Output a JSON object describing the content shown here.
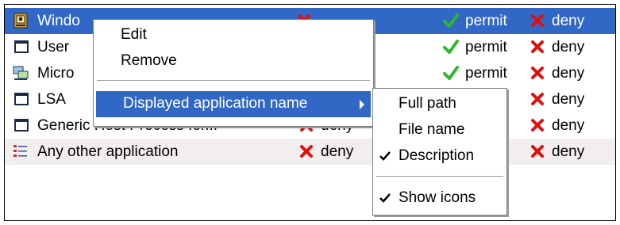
{
  "rules": [
    {
      "name": "Windows NT Logon App",
      "icon": "windows-logon-icon",
      "allow1_label": "deny",
      "allow1": false,
      "allow2_label": "permit",
      "allow2": true,
      "allow3_label": "deny",
      "allow3": false
    },
    {
      "name": "User",
      "icon": "window-icon",
      "allow1_label": "",
      "allow1": null,
      "allow2_label": "permit",
      "allow2": true,
      "allow3_label": "deny",
      "allow3": false
    },
    {
      "name": "Micro",
      "icon": "network-computer-icon",
      "allow1_label": "",
      "allow1": null,
      "allow2_label": "permit",
      "allow2": true,
      "allow3_label": "deny",
      "allow3": false
    },
    {
      "name": "LSA",
      "icon": "window-icon",
      "allow1_label": "",
      "allow1": null,
      "allow2_label": "",
      "allow2": null,
      "allow3_label": "deny",
      "allow3": false
    },
    {
      "name": "Generic Host Process for...",
      "icon": "window-icon",
      "allow1_label": "deny",
      "allow1": false,
      "allow2_label": "",
      "allow2": null,
      "allow3_label": "deny",
      "allow3": false
    },
    {
      "name": "Any other application",
      "icon": "list-icon",
      "allow1_label": "deny",
      "allow1": false,
      "allow2_label": "",
      "allow2": null,
      "allow3_label": "deny",
      "allow3": false
    }
  ],
  "row0_visible_name": "Windo",
  "context_menu": {
    "edit": "Edit",
    "remove": "Remove",
    "displayed_name": "Displayed application name"
  },
  "submenu": {
    "full_path": "Full path",
    "file_name": "File name",
    "description": "Description",
    "show_icons": "Show icons",
    "description_checked": true,
    "show_icons_checked": true
  },
  "colors": {
    "selection": "#3168c6",
    "permit_check": "#2db82d",
    "deny_x": "#e01010",
    "alt_row": "#f3eeee"
  }
}
